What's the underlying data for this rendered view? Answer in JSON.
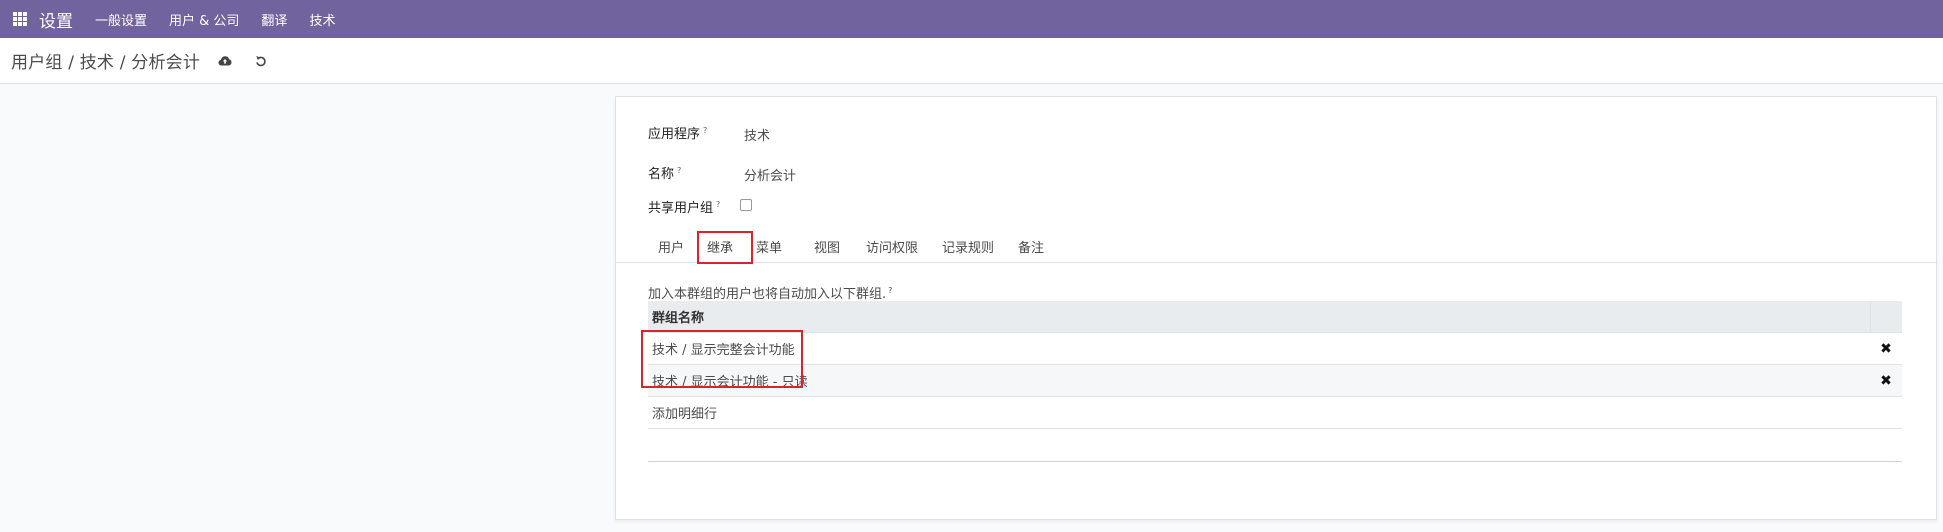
{
  "navbar": {
    "brand": "设置",
    "menu": [
      "一般设置",
      "用户 & 公司",
      "翻译",
      "技术"
    ]
  },
  "control_panel": {
    "breadcrumb": "用户组 / 技术 / 分析会计"
  },
  "form": {
    "application_label": "应用程序",
    "application_value": "技术",
    "name_label": "名称",
    "name_value": "分析会计",
    "share_label": "共享用户组",
    "share_checked": false,
    "help_mark": "?"
  },
  "tabs": [
    "用户",
    "继承",
    "菜单",
    "视图",
    "访问权限",
    "记录规则",
    "备注"
  ],
  "active_tab": "继承",
  "inherited": {
    "help_text": "加入本群组的用户也将自动加入以下群组.",
    "column_header": "群组名称",
    "rows": [
      "技术 / 显示完整会计功能",
      "技术 / 显示会计功能 - 只读"
    ],
    "add_line": "添加明细行",
    "delete_glyph": "✖"
  },
  "colors": {
    "navbar": "#71639e",
    "highlight": "#d9232e"
  }
}
